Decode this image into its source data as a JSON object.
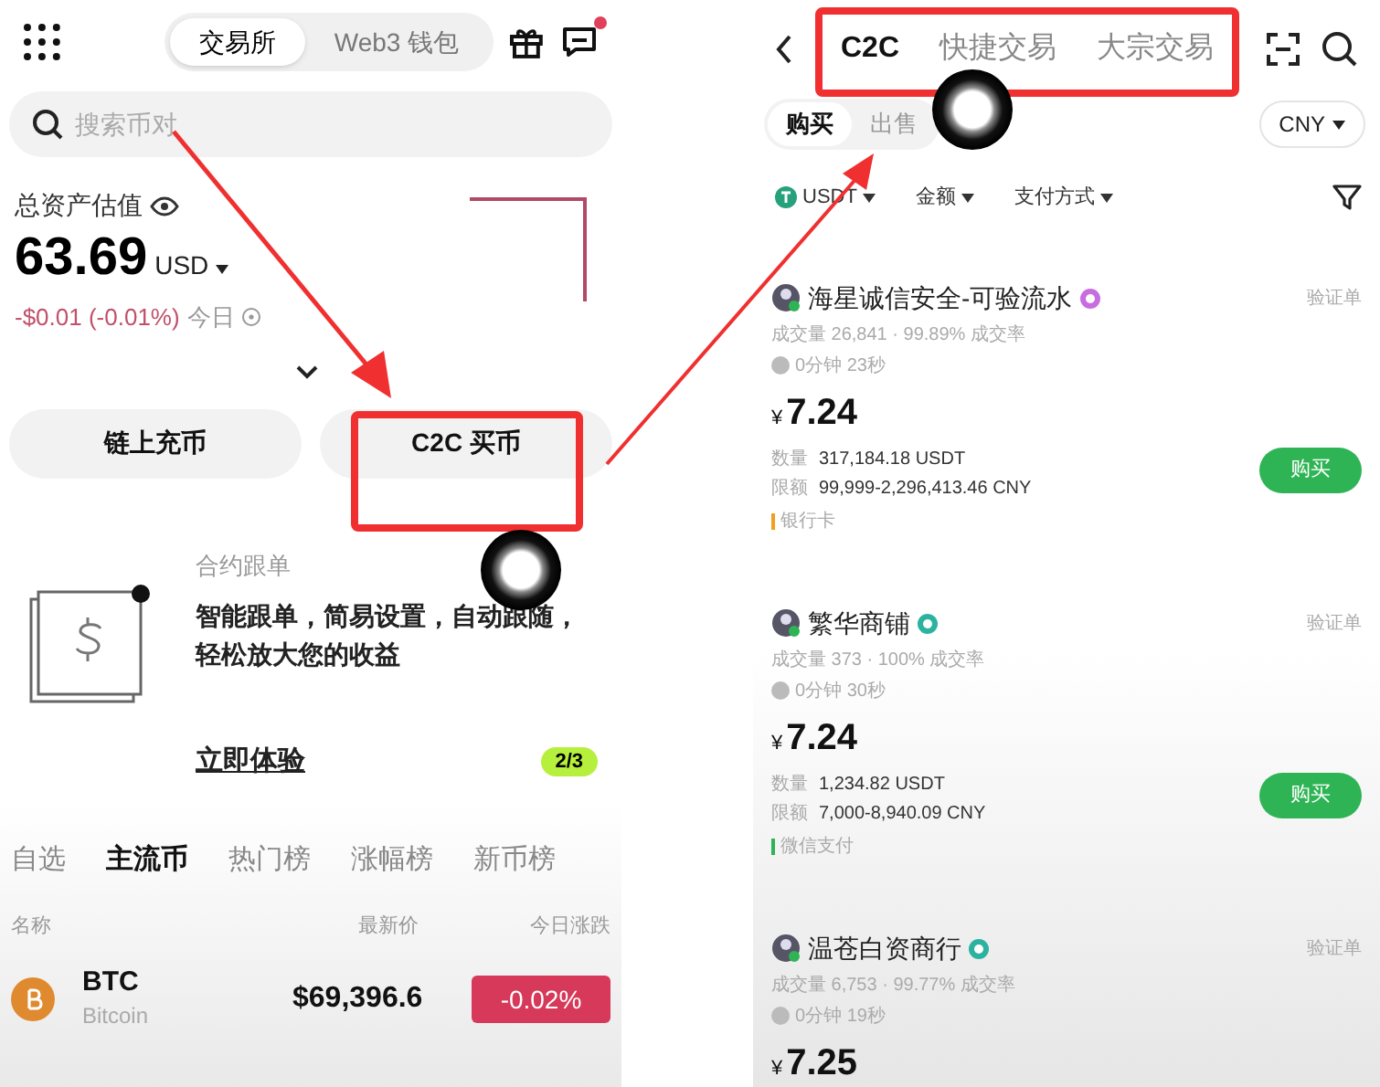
{
  "left": {
    "top_tabs": [
      {
        "label": "交易所",
        "selected": true
      },
      {
        "label": "Web3 钱包",
        "selected": false
      }
    ],
    "messages_unread": true,
    "search": {
      "placeholder": "搜索币对"
    },
    "assets": {
      "label": "总资产估值",
      "value": "63.69",
      "currency": "USD",
      "change": "-$0.01 (-0.01%)",
      "period": "今日"
    },
    "actions": [
      {
        "label": "链上充币"
      },
      {
        "label": "C2C 买币"
      }
    ],
    "promo": {
      "title": "合约跟单",
      "text": "智能跟单，简易设置，自动跟随，轻松放大您的收益",
      "link": "立即体验",
      "page": "2/3"
    },
    "market_tabs": [
      {
        "label": "自选",
        "selected": false
      },
      {
        "label": "主流币",
        "selected": true
      },
      {
        "label": "热门榜",
        "selected": false
      },
      {
        "label": "涨幅榜",
        "selected": false
      },
      {
        "label": "新币榜",
        "selected": false
      }
    ],
    "columns": [
      "名称",
      "最新价",
      "今日涨跌"
    ],
    "rows": [
      {
        "symbol": "BTC",
        "name": "Bitcoin",
        "price": "$69,396.6",
        "change": "-0.02%",
        "color": "#d6395a"
      }
    ]
  },
  "right": {
    "tabs": [
      {
        "label": "C2C",
        "selected": true
      },
      {
        "label": "快捷交易",
        "selected": false
      },
      {
        "label": "大宗交易",
        "selected": false
      }
    ],
    "sides": [
      {
        "label": "购买",
        "selected": true
      },
      {
        "label": "出售",
        "selected": false
      }
    ],
    "currency": "CNY",
    "filters": [
      {
        "label": "USDT",
        "kind": "coin"
      },
      {
        "label": "金额",
        "kind": "plain"
      },
      {
        "label": "支付方式",
        "kind": "plain"
      }
    ],
    "offers": [
      {
        "name": "海星诚信安全-可验流水",
        "badge": {
          "color": "#c86de0"
        },
        "tag": "验证单",
        "stats": "成交量 26,841 · 99.89% 成交率",
        "time": "0分钟 23秒",
        "currency_symbol": "¥",
        "price": "7.24",
        "quantity_label": "数量",
        "quantity": "317,184.18 USDT",
        "limit_label": "限额",
        "limit": "99,999-2,296,413.46 CNY",
        "payment": {
          "label": "银行卡",
          "color": "#f0a020"
        },
        "action": "购买"
      },
      {
        "name": "繁华商铺",
        "badge": {
          "color": "#2bb3a0"
        },
        "tag": "验证单",
        "stats": "成交量 373 · 100% 成交率",
        "time": "0分钟 30秒",
        "currency_symbol": "¥",
        "price": "7.24",
        "quantity_label": "数量",
        "quantity": "1,234.82 USDT",
        "limit_label": "限额",
        "limit": "7,000-8,940.09 CNY",
        "payment": {
          "label": "微信支付",
          "color": "#2fb455"
        },
        "action": "购买"
      },
      {
        "name": "温苍白资商行",
        "badge": {
          "color": "#2bb3a0"
        },
        "tag": "验证单",
        "stats": "成交量 6,753 · 99.77% 成交率",
        "time": "0分钟 19秒",
        "currency_symbol": "¥",
        "price": "7.25"
      }
    ]
  }
}
